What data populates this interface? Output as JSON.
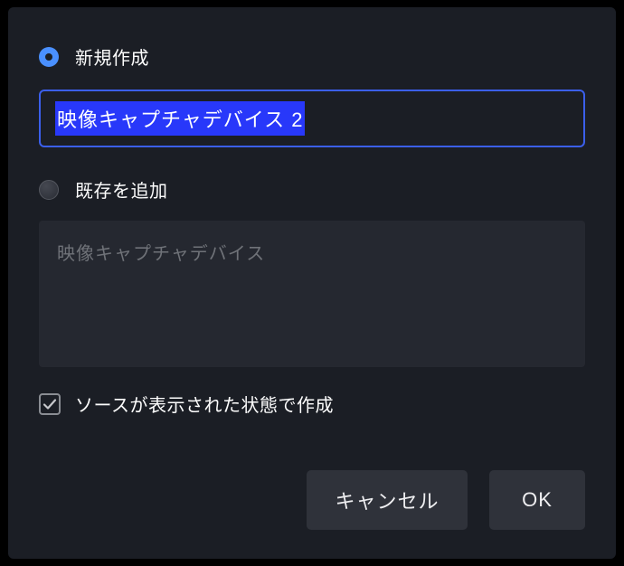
{
  "radio_create_label": "新規作成",
  "radio_add_existing_label": "既存を追加",
  "input_value": "映像キャプチャデバイス 2",
  "existing_list": {
    "item": "映像キャプチャデバイス"
  },
  "checkbox_label": "ソースが表示された状態で作成",
  "checkbox_checked": true,
  "buttons": {
    "cancel": "キャンセル",
    "ok": "OK"
  }
}
